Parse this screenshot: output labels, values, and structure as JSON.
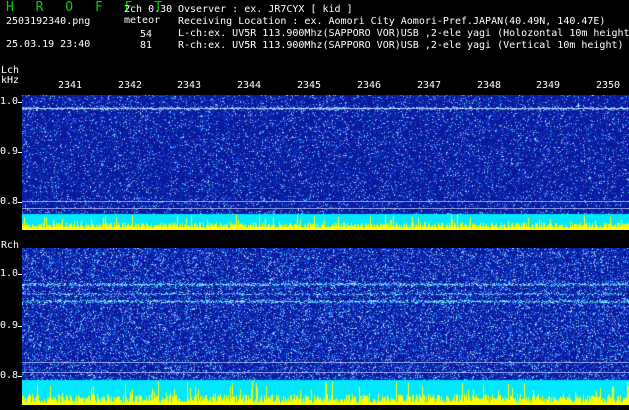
{
  "header": {
    "brand": "H R O F F T",
    "filename": "2503192340.png",
    "timestamp": "25.03.19 23:40",
    "mode": "2ch 0.30",
    "event_type": "meteor",
    "lch_count": "54",
    "rch_count": "81",
    "observer": "Ovserver            : ex. JR7CYX [ kid ]",
    "location": "Receiving Location : ex. Aomori City Aomori-Pref.JAPAN(40.49N, 140.47E)",
    "lch_info": "L-ch:ex. UV5R 113.900Mhz(SAPPORO VOR)USB ,2-ele yagi (Holozontal 10m height)",
    "rch_info": "R-ch:ex. UV5R 113.900Mhz(SAPPORO VOR)USB ,2-ele yagi (Vertical 10m height)"
  },
  "lch": {
    "label": "Lch",
    "unit": "kHz",
    "y_ticks": [
      "1.0",
      "0.9",
      "0.8"
    ],
    "time_ticks": [
      "2341",
      "2342",
      "2343",
      "2344",
      "2345",
      "2346",
      "2347",
      "2348",
      "2349",
      "2350"
    ]
  },
  "rch": {
    "label": "Rch",
    "y_ticks": [
      "1.0",
      "0.9",
      "0.8"
    ]
  },
  "colors": {
    "noise_bg": "#0a1a9e",
    "signal_line": "#40e0ff",
    "level_cyan": "#00e8ff",
    "level_yellow": "#ffff00",
    "brand_green": "#00d000"
  }
}
